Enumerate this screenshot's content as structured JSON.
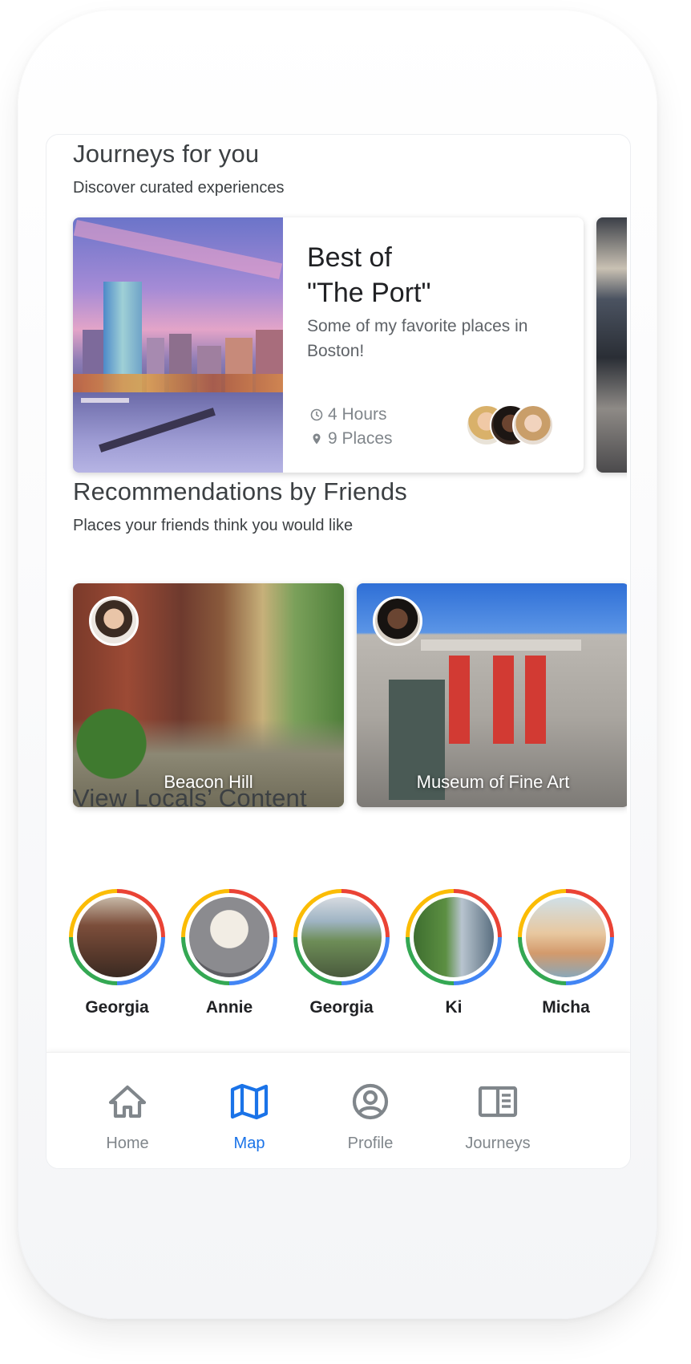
{
  "journeys": {
    "title": "Journeys for you",
    "subtitle": "Discover curated experiences",
    "card": {
      "title": "Best of\n\"The Port\"",
      "description": "Some of my favorite places in Boston!",
      "duration": "4 Hours",
      "places": "9 Places"
    }
  },
  "recommendations": {
    "title": "Recommendations by Friends",
    "subtitle": "Places your friends think you would like",
    "cards": [
      {
        "label": "Beacon Hill"
      },
      {
        "label": "Museum of Fine Art"
      }
    ]
  },
  "locals": {
    "title": "View Locals’ Content",
    "people": [
      {
        "name": "Georgia"
      },
      {
        "name": "Annie"
      },
      {
        "name": "Georgia"
      },
      {
        "name": "Ki"
      },
      {
        "name": "Micha"
      }
    ]
  },
  "nav": {
    "items": [
      {
        "label": "Home",
        "icon": "home-icon"
      },
      {
        "label": "Map",
        "icon": "map-icon",
        "active": true
      },
      {
        "label": "Profile",
        "icon": "profile-icon"
      },
      {
        "label": "Journeys",
        "icon": "journeys-icon"
      }
    ],
    "active_color": "#1a73e8",
    "inactive_color": "#80868b"
  }
}
